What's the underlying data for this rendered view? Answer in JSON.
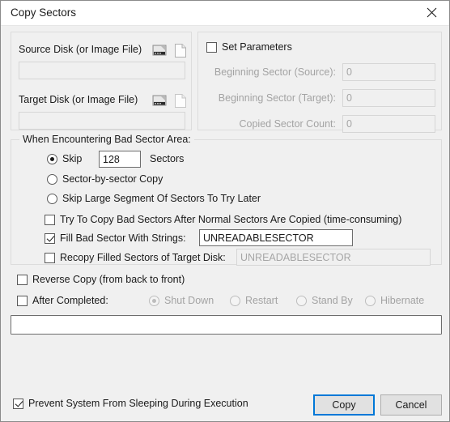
{
  "window": {
    "title": "Copy Sectors",
    "close_icon": "close-icon"
  },
  "source_panel": {
    "source_label": "Source Disk (or Image File)",
    "source_disk_icon": "hard-disk-icon",
    "source_file_icon": "file-icon",
    "source_value": "",
    "target_label": "Target Disk (or Image File)",
    "target_disk_icon": "hard-disk-icon",
    "target_file_icon": "file-icon",
    "target_value": ""
  },
  "parameters_panel": {
    "set_parameters_label": "Set Parameters",
    "set_parameters_checked": false,
    "rows": [
      {
        "label": "Beginning Sector (Source):",
        "value": "0"
      },
      {
        "label": "Beginning Sector (Target):",
        "value": "0"
      },
      {
        "label": "Copied Sector Count:",
        "value": "0"
      }
    ]
  },
  "bad_sector_group": {
    "title": "When Encountering Bad Sector Area:",
    "skip_label": "Skip",
    "skip_value": "128",
    "skip_units": "Sectors",
    "sector_by_sector_label": "Sector-by-sector Copy",
    "skip_large_label": "Skip Large Segment Of Sectors To Try Later",
    "try_copy_label": "Try To Copy Bad Sectors After Normal Sectors Are Copied (time-consuming)",
    "fill_label": "Fill Bad Sector With Strings:",
    "fill_value": "UNREADABLESECTOR",
    "recopy_label": "Recopy Filled Sectors of Target Disk:",
    "recopy_value": "UNREADABLESECTOR"
  },
  "options": {
    "reverse_copy_label": "Reverse Copy (from back to front)",
    "after_completed_label": "After Completed:",
    "after_completed_options": [
      "Shut Down",
      "Restart",
      "Stand By",
      "Hibernate"
    ],
    "after_completed_selected": "Shut Down"
  },
  "log": {
    "value": ""
  },
  "footer": {
    "prevent_sleep_label": "Prevent System From Sleeping During Execution",
    "copy_button": "Copy",
    "cancel_button": "Cancel"
  },
  "colors": {
    "accent": "#0078d7",
    "dialog_bg": "#f0f0f0",
    "titlebar_bg": "#ffffff",
    "disabled_text": "#a3a3a3"
  }
}
